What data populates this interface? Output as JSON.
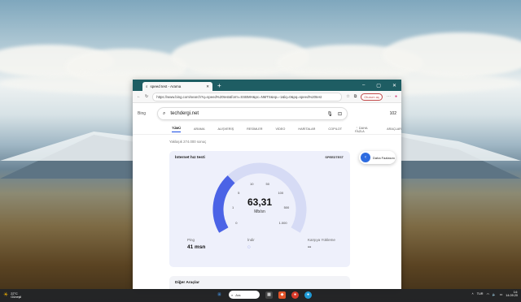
{
  "browser": {
    "tab_title": "speed test - Arama",
    "url": "https://www.bing.com/search?q=speed%20test&form=SSBMH&pc=NMTS&sp=-1&lq=0&pq=speed%20test",
    "profile_label": "Oturum aç",
    "zoom_badge": "A"
  },
  "bing": {
    "logo": "Bing",
    "query": "techdergi.net",
    "rewards_count": "102",
    "nav_tabs": [
      "TÜMÜ",
      "ARAMA",
      "ALIŞVERİŞ",
      "RESİMLER",
      "VİDEO",
      "HARİTALAR",
      "COPILOT",
      "⋮ DAHA FAZLA",
      "ARAÇLAR"
    ],
    "results_meta": "Yaklaşık 274.000 sonuç"
  },
  "speedtest": {
    "title": "İnternet hız testi",
    "brand": "SPEEDTEST",
    "value": "63,31",
    "unit": "Mb/sn",
    "gauge_ticks": [
      "0",
      "1",
      "5",
      "10",
      "50",
      "100",
      "500",
      "1.000"
    ],
    "gauge_level": 0.32,
    "ping_label": "Ping",
    "ping_value": "41 msn",
    "download_label": "İndir",
    "upload_label": "Karşıya Yükleme",
    "upload_value": "--"
  },
  "other_tools": "Diğer Araçlar",
  "sidebar_float": "Daha Fazlasını",
  "taskbar": {
    "temp": "22°C",
    "weather": "Güneşli",
    "search_label": "Ara",
    "lang": "TUR",
    "time": "14:",
    "date": "14.09.20"
  },
  "colors": {
    "accent": "#174ae4",
    "gauge_fill": "#4b63e6",
    "gauge_track": "#d6dbf5",
    "tab_bar": "#1e5d63"
  }
}
